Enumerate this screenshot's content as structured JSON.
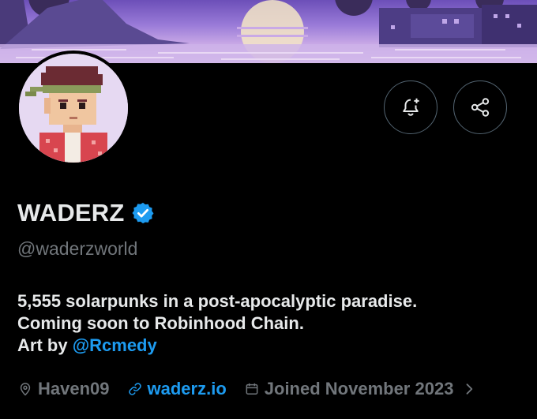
{
  "profile": {
    "display_name": "WADERZ",
    "handle": "@waderzworld",
    "bio_line1": "5,555 solarpunks in a post-apocalyptic paradise.",
    "bio_line2": "Coming soon to Robinhood Chain.",
    "bio_line3_prefix": "Art by ",
    "bio_mention": "@Rcmedy",
    "location": "Haven09",
    "website": "waderz.io",
    "joined": "Joined November 2023"
  },
  "icons": {
    "notify": "bell-plus-icon",
    "share": "share-icon",
    "verified": "verified-badge-icon",
    "location": "location-pin-icon",
    "link": "link-icon",
    "calendar": "calendar-icon",
    "chevron": "chevron-right-icon"
  },
  "colors": {
    "background": "#000000",
    "text_primary": "#e7e9ea",
    "text_secondary": "#71767b",
    "accent": "#1d9bf0",
    "button_border": "#536471"
  }
}
